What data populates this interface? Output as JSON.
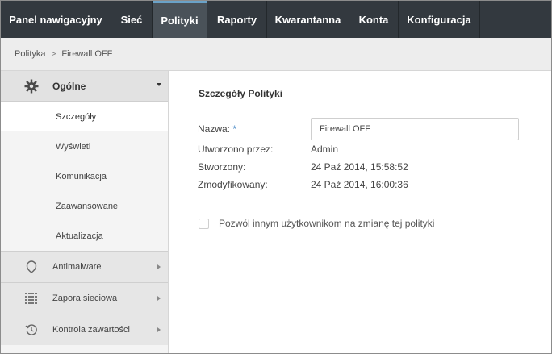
{
  "topnav": {
    "tabs": [
      {
        "label": "Panel nawigacyjny"
      },
      {
        "label": "Sieć"
      },
      {
        "label": "Polityki"
      },
      {
        "label": "Raporty"
      },
      {
        "label": "Kwarantanna"
      },
      {
        "label": "Konta"
      },
      {
        "label": "Konfiguracja"
      }
    ],
    "active": "Polityki"
  },
  "breadcrumb": {
    "items": [
      "Polityka",
      "Firewall OFF"
    ],
    "separator": ">"
  },
  "sidebar": {
    "expanded": {
      "label": "Ogólne",
      "icon": "gear-icon",
      "items": [
        {
          "label": "Szczegóły"
        },
        {
          "label": "Wyświetl"
        },
        {
          "label": "Komunikacja"
        },
        {
          "label": "Zaawansowane"
        },
        {
          "label": "Aktualizacja"
        }
      ],
      "active": "Szczegóły"
    },
    "sections": [
      {
        "label": "Antimalware",
        "icon": "shield-icon"
      },
      {
        "label": "Zapora sieciowa",
        "icon": "firewall-grid-icon"
      },
      {
        "label": "Kontrola zawartości",
        "icon": "history-clock-icon"
      }
    ]
  },
  "details": {
    "title": "Szczegóły Polityki",
    "name_label": "Nazwa:",
    "required_mark": "*",
    "name_value": "Firewall OFF",
    "created_by_label": "Utworzono przez:",
    "created_by_value": "Admin",
    "created_label": "Stworzony:",
    "created_value": "24 Paź 2014, 15:58:52",
    "modified_label": "Zmodyfikowany:",
    "modified_value": "24 Paź 2014, 16:00:36",
    "allow_others_label": "Pozwól innym użytkownikom na zmianę tej polityki",
    "allow_others_checked": false
  },
  "colors": {
    "topnav_bg": "#33393f",
    "active_tab_bg": "#4a5259",
    "active_tab_accent": "#6aa2c8",
    "required": "#3a7fc1"
  }
}
